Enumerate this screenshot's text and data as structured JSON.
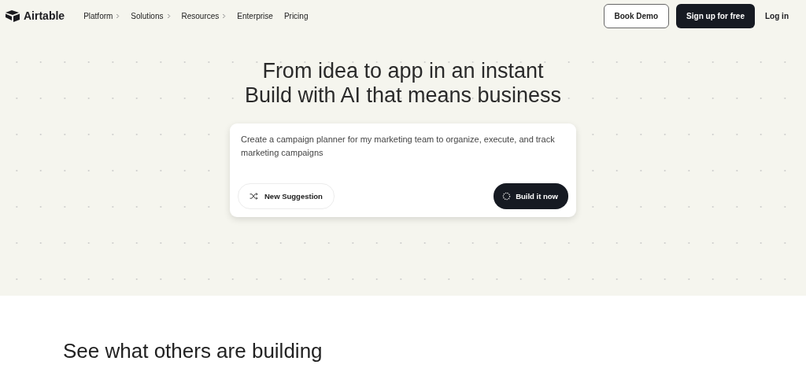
{
  "brand": {
    "name": "Airtable"
  },
  "nav": [
    {
      "label": "Platform",
      "has_menu": true
    },
    {
      "label": "Solutions",
      "has_menu": true
    },
    {
      "label": "Resources",
      "has_menu": true
    },
    {
      "label": "Enterprise",
      "has_menu": false
    },
    {
      "label": "Pricing",
      "has_menu": false
    }
  ],
  "actions": [
    {
      "label": "Book Demo",
      "kind": "outline"
    },
    {
      "label": "Sign up for free",
      "kind": "solid"
    },
    {
      "label": "Log in",
      "kind": "link"
    }
  ],
  "hero": {
    "title_lines": [
      "From idea to app in an instant",
      "Build with AI that means business"
    ],
    "prompt": {
      "value": "Create a campaign planner for my marketing team to organize, execute, and track marketing campaigns"
    },
    "suggestion_button": "New Suggestion",
    "build_button": "Build it now"
  },
  "section": {
    "heading": "See what others are building"
  }
}
